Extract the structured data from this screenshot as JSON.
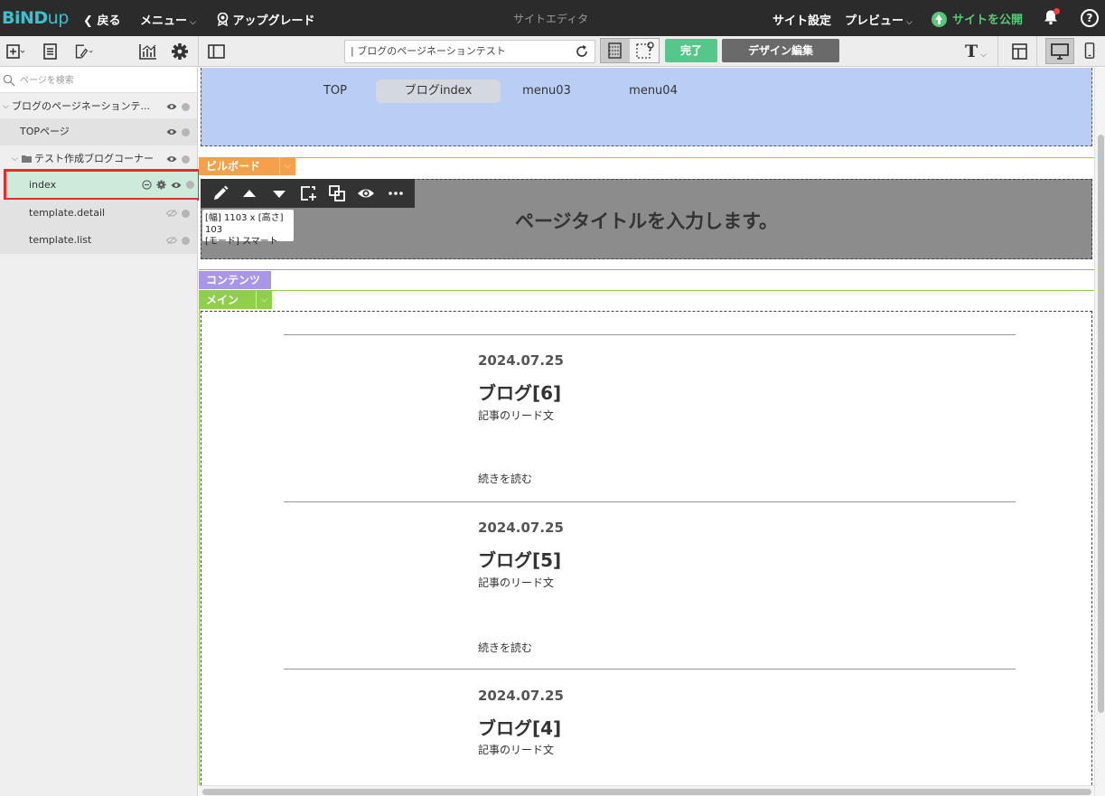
{
  "topbar": {
    "logo_b": "BiND",
    "logo_up": "up",
    "back": "戻る",
    "menu": "メニュー",
    "upgrade": "アップグレード",
    "center_title": "サイトエディタ",
    "site_settings": "サイト設定",
    "preview": "プレビュー",
    "publish": "サイトを公開",
    "help": "?"
  },
  "toolbar": {
    "url": "| ブログのページネーションテスト",
    "done": "完了",
    "design_edit": "デザイン編集",
    "text_style": "T"
  },
  "sidebar": {
    "search_placeholder": "ページを検索",
    "items": [
      {
        "label": "ブログのページネーションテ..."
      },
      {
        "label": "TOPページ"
      },
      {
        "label": "テスト作成ブログコーナー"
      },
      {
        "label": "index"
      },
      {
        "label": "template.detail"
      },
      {
        "label": "template.list"
      }
    ]
  },
  "canvas": {
    "nav": [
      "TOP",
      "ブログindex",
      "menu03",
      "menu04"
    ],
    "billboard_tag": "ビルボード",
    "billboard_title": "ページタイトルを入力します。",
    "size_tip_line1": "[幅] 1103 x [高さ] 103",
    "size_tip_line2": "[モード] スマート",
    "contents_tag": "コンテンツ",
    "main_tag": "メイン",
    "posts": [
      {
        "date": "2024.07.25",
        "title": "ブログ[6]",
        "lead": "記事のリード文",
        "more": "続きを読む"
      },
      {
        "date": "2024.07.25",
        "title": "ブログ[5]",
        "lead": "記事のリード文",
        "more": "続きを読む"
      },
      {
        "date": "2024.07.25",
        "title": "ブログ[4]",
        "lead": "記事のリード文"
      }
    ]
  },
  "colors": {
    "topbar_bg": "#2b2b2b",
    "accent_green": "#55c78a",
    "nav_band": "#b9cdf5",
    "billboard_tag": "#f5a04a",
    "contents_tag": "#a996e8",
    "main_tag": "#8fcf4c",
    "selection_border": "#e52b2b"
  }
}
